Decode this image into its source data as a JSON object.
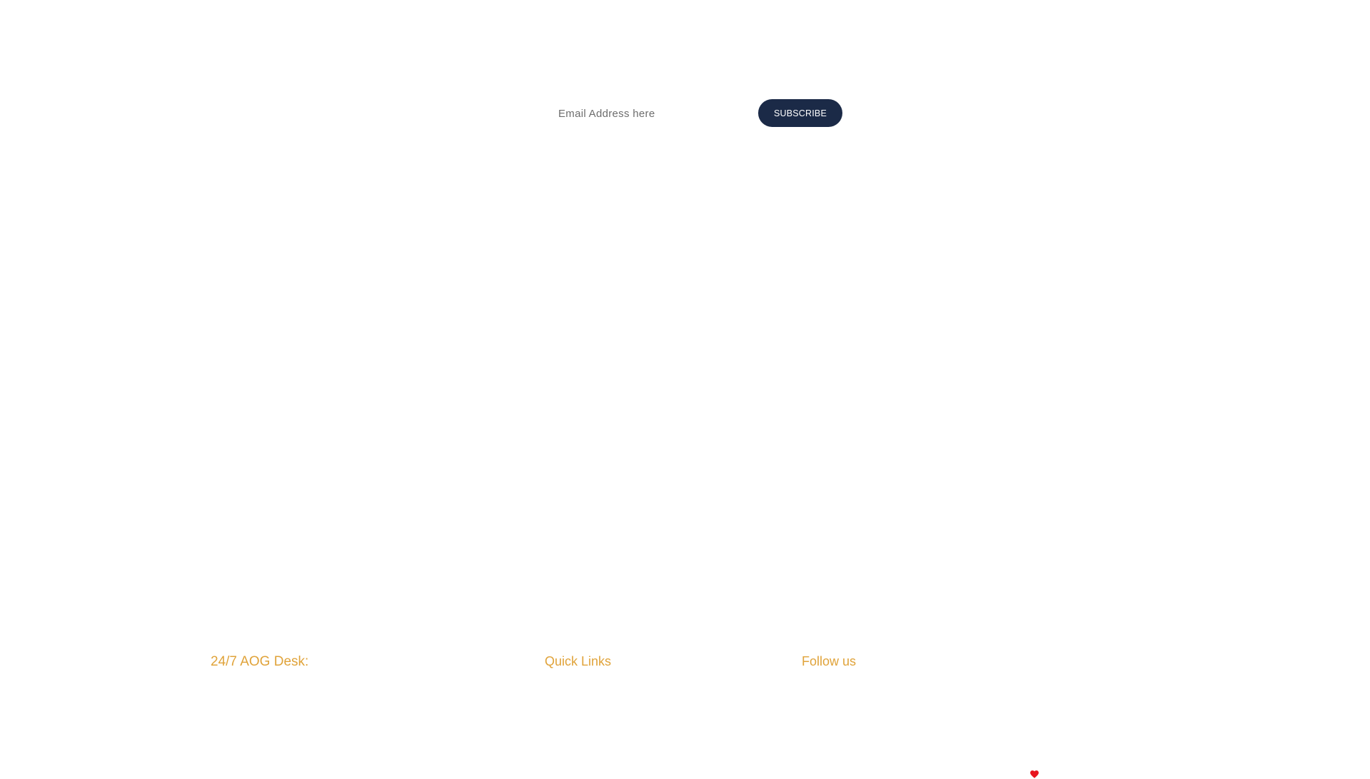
{
  "newsletter": {
    "email_placeholder": "Email Address here",
    "subscribe_label": "SUBSCRIBE"
  },
  "footer": {
    "aog_desk_heading": "24/7 AOG Desk:",
    "quick_links_heading": "Quick Links",
    "follow_us_heading": "Follow us",
    "heart_icon": "heart-icon"
  },
  "colors": {
    "accent_gold": "#e0a33a",
    "button_navy": "#1b2a47",
    "heart_red": "#e8141e",
    "background": "#ffffff"
  }
}
